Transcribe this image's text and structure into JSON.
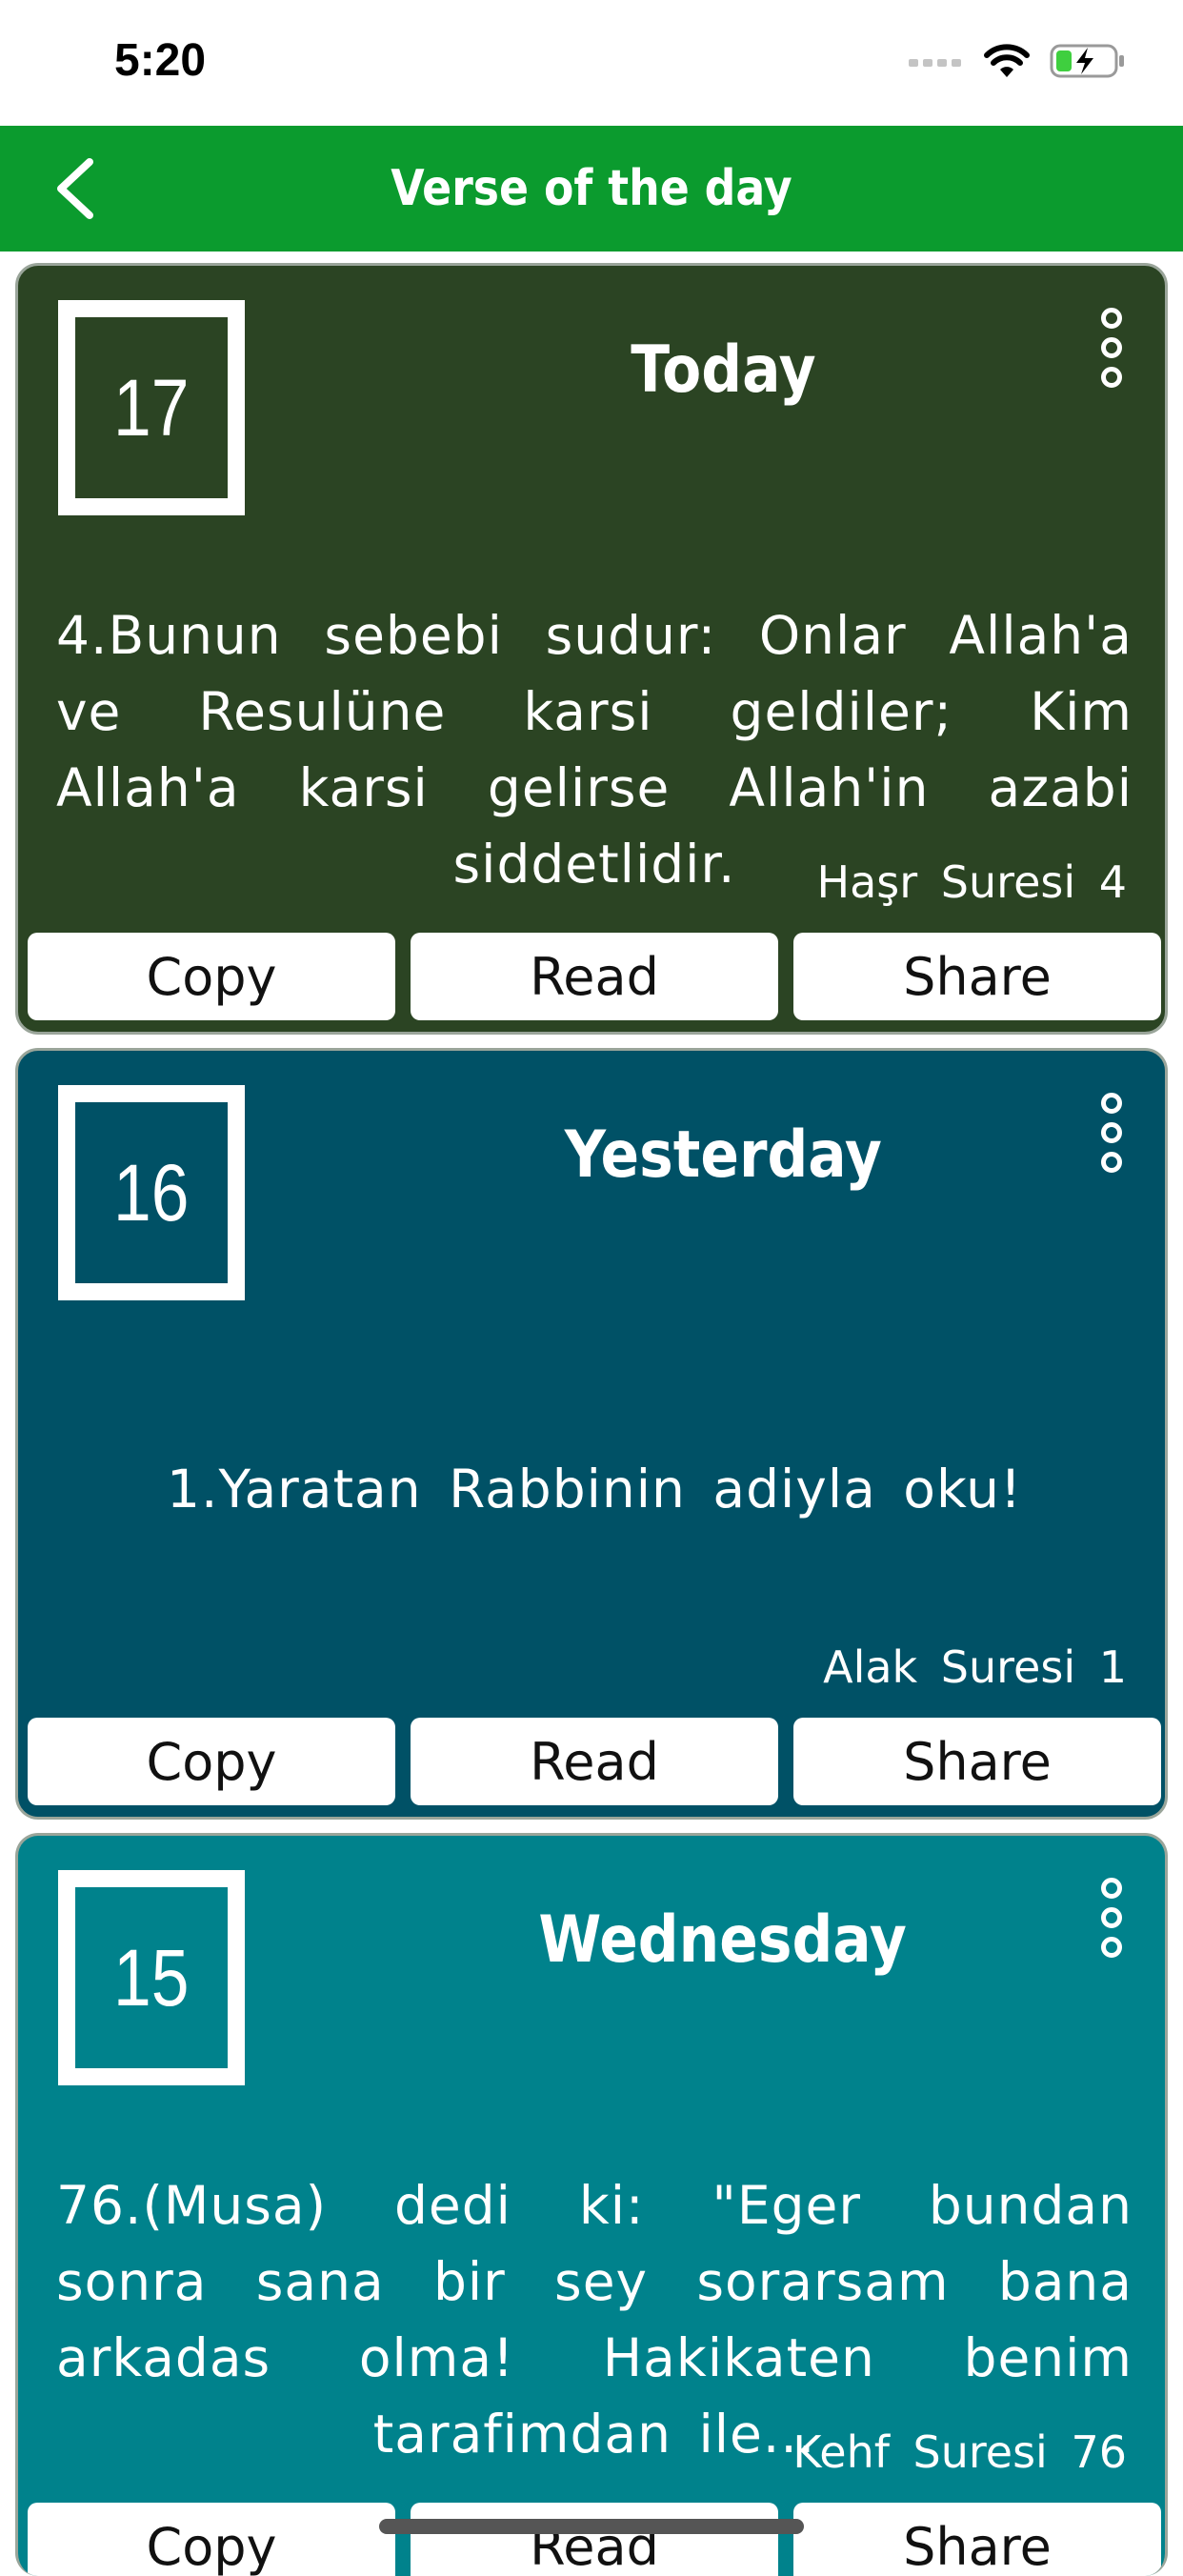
{
  "status_bar": {
    "time": "5:20"
  },
  "nav": {
    "title": "Verse of the day"
  },
  "colors": {
    "nav_bar": "#0b9b2e",
    "card_today": "#2b4423",
    "card_yesterday": "#005166",
    "card_wednesday": "#00828c"
  },
  "cards": [
    {
      "day_number": "17",
      "day_label": "Today",
      "verse": "4.Bunun sebebi sudur: Onlar Allah'a ve Resulüne karsi geldiler; Kim Allah'a karsi gelirse Allah'in azabi siddetlidir.",
      "reference": "Haşr Suresi 4",
      "actions": {
        "copy": "Copy",
        "read": "Read",
        "share": "Share"
      }
    },
    {
      "day_number": "16",
      "day_label": "Yesterday",
      "verse": "1.Yaratan Rabbinin adiyla oku!",
      "reference": "Alak Suresi 1",
      "actions": {
        "copy": "Copy",
        "read": "Read",
        "share": "Share"
      }
    },
    {
      "day_number": "15",
      "day_label": "Wednesday",
      "verse": "76.(Musa) dedi ki: \"Eger bundan sonra sana bir sey sorarsam bana arkadas olma! Hakikaten benim tarafimdan ile...",
      "reference": "Kehf Suresi 76",
      "actions": {
        "copy": "Copy",
        "read": "Read",
        "share": "Share"
      }
    }
  ]
}
